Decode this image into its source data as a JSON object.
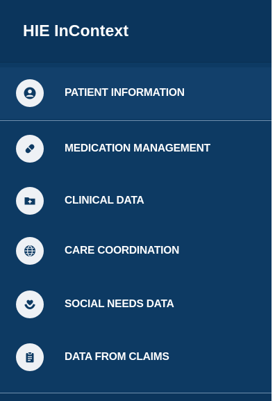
{
  "header": {
    "title": "HIE InContext"
  },
  "nav": {
    "items": [
      {
        "label": "PATIENT INFORMATION",
        "icon": "user-circle-icon",
        "active": true
      },
      {
        "label": "MEDICATION MANAGEMENT",
        "icon": "pill-icon",
        "active": false
      },
      {
        "label": "CLINICAL DATA",
        "icon": "medical-folder-icon",
        "active": false
      },
      {
        "label": "CARE COORDINATION",
        "icon": "network-globe-icon",
        "active": false
      },
      {
        "label": "SOCIAL NEEDS DATA",
        "icon": "hand-heart-icon",
        "active": false
      },
      {
        "label": "DATA FROM CLAIMS",
        "icon": "clipboard-icon",
        "active": false
      }
    ]
  },
  "colors": {
    "panel_bg": "#0d3a63",
    "header_bg": "#0b355c",
    "active_bg": "#12406b",
    "icon_bg": "#eef1f5",
    "icon_fg": "#0d3a63",
    "text": "#ffffff"
  }
}
